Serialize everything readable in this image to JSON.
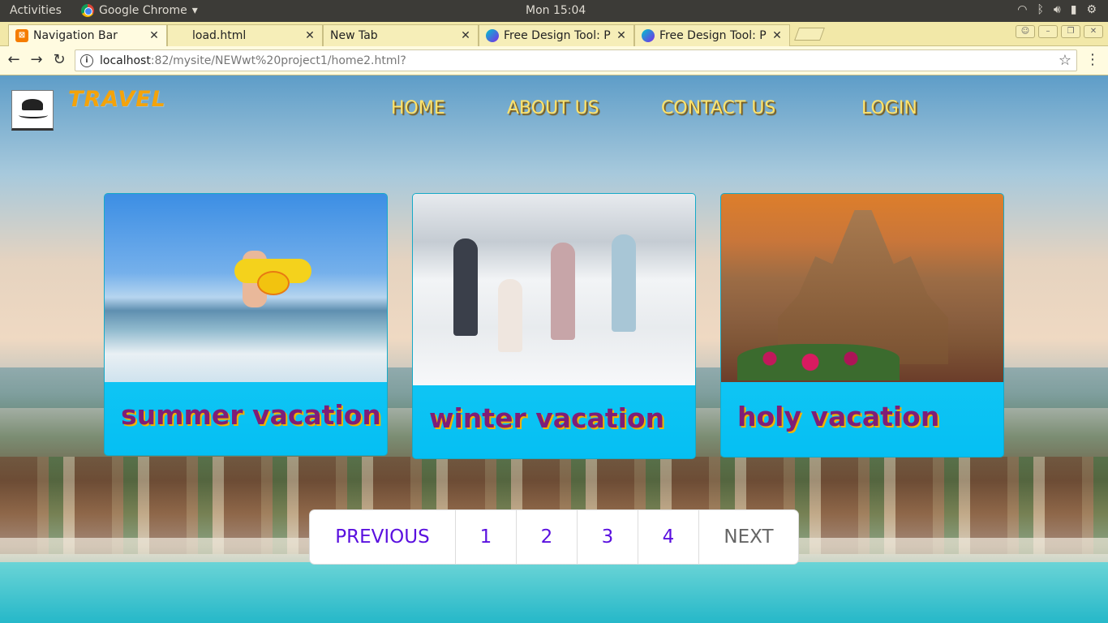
{
  "system_bar": {
    "activities": "Activities",
    "app_name": "Google Chrome",
    "clock": "Mon 15:04"
  },
  "browser": {
    "tabs": [
      {
        "label": "Navigation Bar",
        "favicon": "xampp-icon",
        "active": true
      },
      {
        "label": "load.html",
        "favicon": "",
        "active": false
      },
      {
        "label": "New Tab",
        "favicon": "",
        "active": false
      },
      {
        "label": "Free Design Tool: Pr",
        "favicon": "canva-icon",
        "active": false
      },
      {
        "label": "Free Design Tool: Pr",
        "favicon": "canva-icon",
        "active": false
      }
    ],
    "url_host": "localhost",
    "url_path": ":82/mysite/NEWwt%20project1/home2.html?"
  },
  "site": {
    "brand": "TRAVEL",
    "nav": [
      "HOME",
      "ABOUT US",
      "CONTACT US",
      "LOGIN"
    ],
    "cards": [
      {
        "caption": "summer vacation"
      },
      {
        "caption": "winter vacation"
      },
      {
        "caption": "holy vacation"
      }
    ],
    "pagination": {
      "previous": "PREVIOUS",
      "pages": [
        "1",
        "2",
        "3",
        "4"
      ],
      "next": "NEXT"
    }
  },
  "colors": {
    "brand": "#f4a30a",
    "nav_text": "#ffe36b",
    "card_bg": "#05bff3",
    "caption": "#7f1e77",
    "pagination_link": "#5a10df"
  }
}
